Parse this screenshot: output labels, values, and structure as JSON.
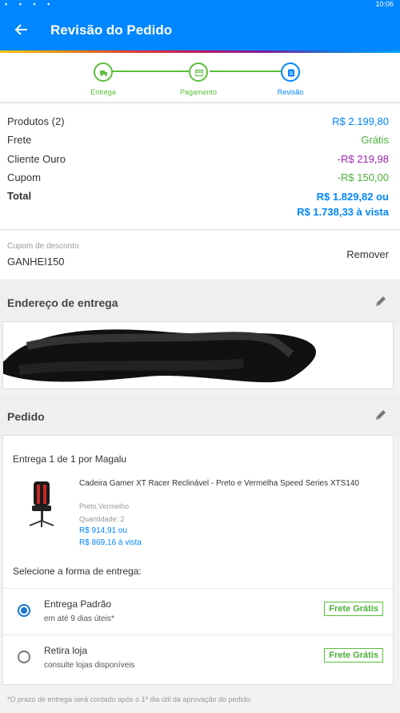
{
  "status_bar": {
    "time": "10:06",
    "icons": [
      "notification-icon",
      "notification-icon",
      "notification-icon",
      "notification-icon"
    ]
  },
  "app_bar": {
    "title": "Revisão do Pedido",
    "back_icon": "arrow-left-icon",
    "background": "#0086ff"
  },
  "colors": {
    "accent_blue": "#0086ff",
    "green": "#4caf3a",
    "purple": "#9c27b0",
    "step_green": "#5bbf3a"
  },
  "steps": [
    {
      "label": "Entrega",
      "icon": "truck-icon",
      "state": "done"
    },
    {
      "label": "Pagamento",
      "icon": "card-icon",
      "state": "done"
    },
    {
      "label": "Revisão",
      "icon": "document-icon",
      "state": "current"
    }
  ],
  "summary": {
    "produtos": {
      "label": "Produtos (2)",
      "value": "R$ 2.199,80"
    },
    "frete": {
      "label": "Frete",
      "value": "Grátis"
    },
    "cliente_ouro": {
      "label": "Cliente Ouro",
      "value": "-R$ 219,98"
    },
    "cupom": {
      "label": "Cupom",
      "value": "-R$ 150,00"
    },
    "total": {
      "label": "Total",
      "value_line1": "R$ 1.829,82 ou",
      "value_line2": "R$ 1.738,33 à vista"
    }
  },
  "coupon": {
    "label": "Cupom de desconto",
    "code": "GANHEI150",
    "remove_label": "Remover"
  },
  "address_section": {
    "title": "Endereço de entrega",
    "edit_icon": "pencil-icon"
  },
  "order_section": {
    "title": "Pedido",
    "edit_icon": "pencil-icon",
    "delivery_title": "Entrega 1 de 1 por Magalu",
    "product": {
      "name": "Cadeira Gamer XT Racer Reclinável - Preto e Vermelha Speed Series XTS140",
      "color": "Preto,Vermelho",
      "quantity": "Quantidade: 2",
      "price_installments": "R$ 914,91 ou",
      "price_cash": "R$ 869,16 à vista",
      "image_icon": "gaming-chair-icon"
    },
    "select_label": "Selecione a forma de entrega:",
    "options": [
      {
        "name": "Entrega Padrão",
        "detail": "em até 9 dias úteis*",
        "badge": "Frete Grátis",
        "selected": true
      },
      {
        "name": "Retira loja",
        "detail": "consulte lojas disponíveis",
        "badge": "Frete Grátis",
        "selected": false
      }
    ]
  },
  "footnote": "*O prazo de entrega será contado após o 1º dia útil da aprovação do pedido."
}
